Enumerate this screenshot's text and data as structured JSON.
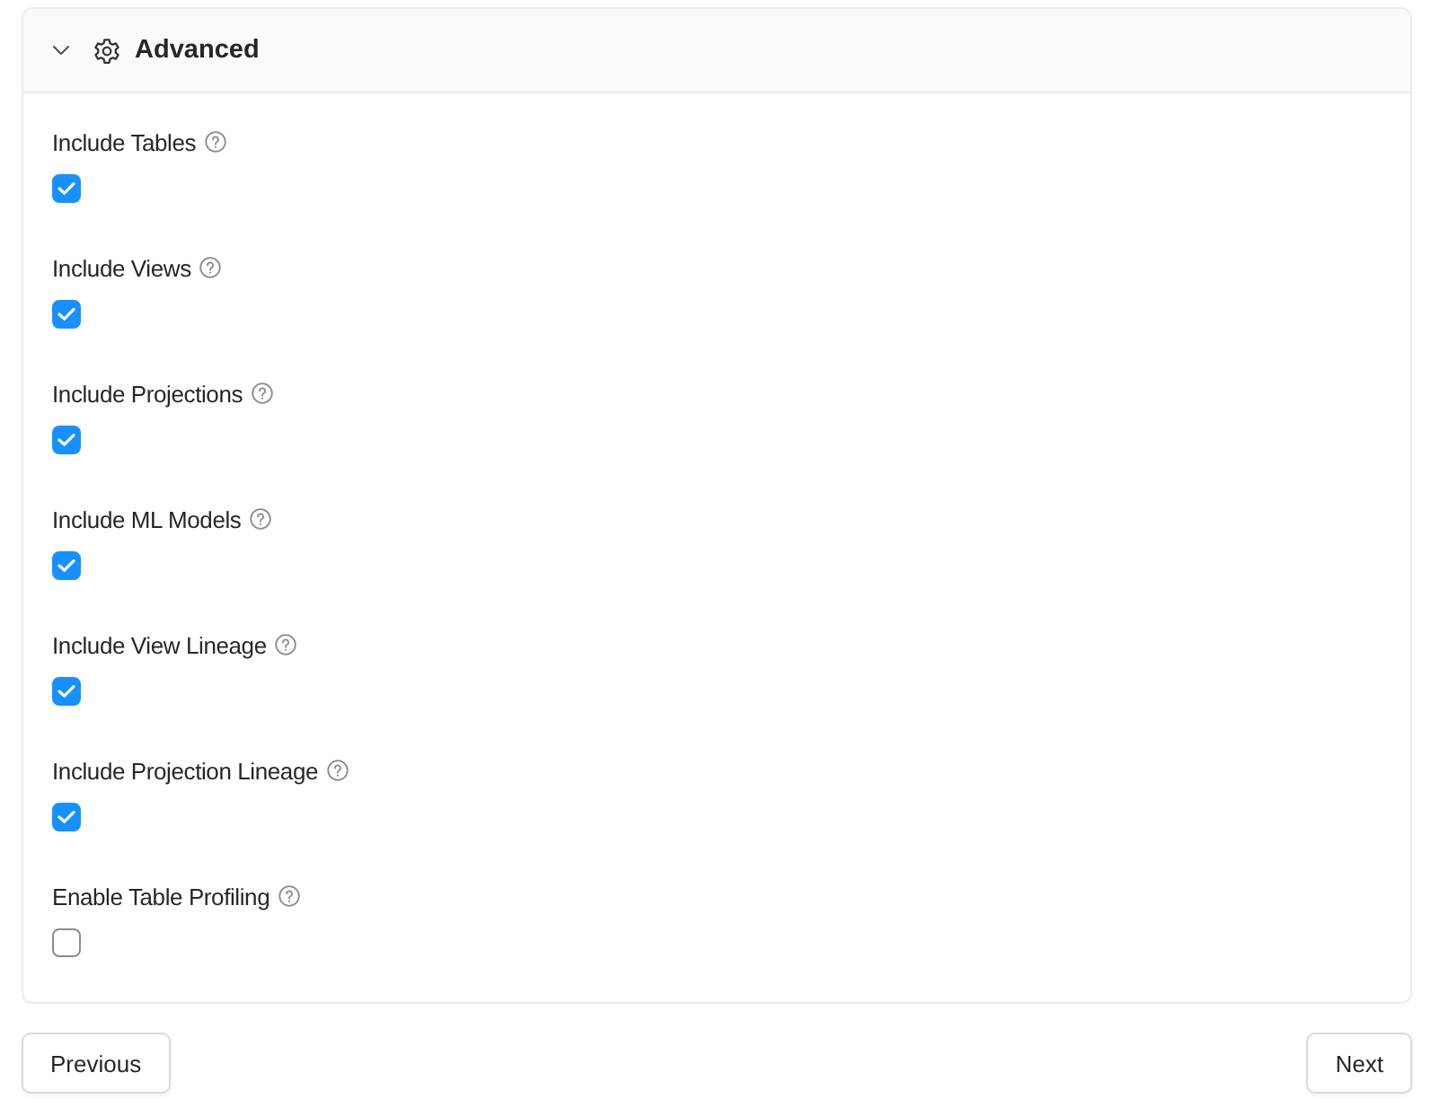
{
  "section": {
    "title": "Advanced",
    "expanded": true
  },
  "options": [
    {
      "label": "Include Tables",
      "checked": true
    },
    {
      "label": "Include Views",
      "checked": true
    },
    {
      "label": "Include Projections",
      "checked": true
    },
    {
      "label": "Include ML Models",
      "checked": true
    },
    {
      "label": "Include View Lineage",
      "checked": true
    },
    {
      "label": "Include Projection Lineage",
      "checked": true
    },
    {
      "label": "Enable Table Profiling",
      "checked": false
    }
  ],
  "buttons": [
    {
      "label": "Previous"
    },
    {
      "label": "Next"
    }
  ]
}
